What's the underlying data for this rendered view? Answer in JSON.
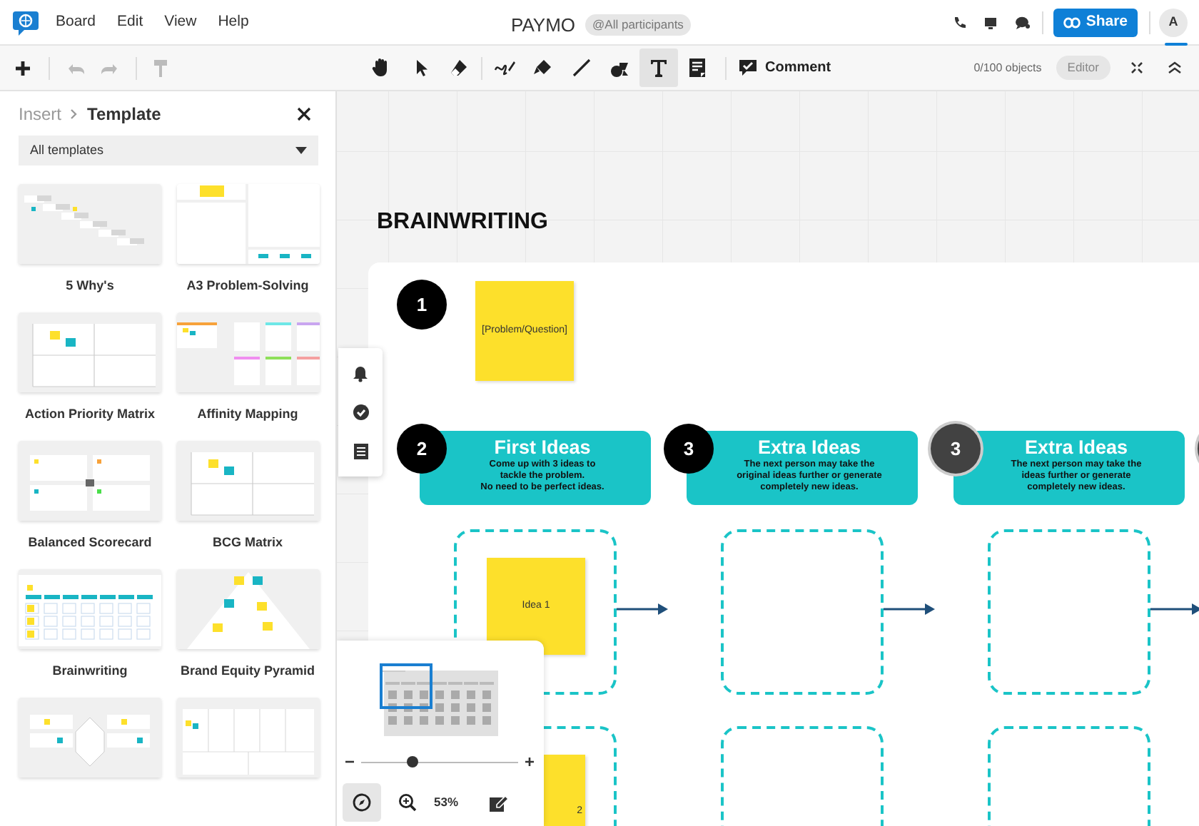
{
  "menu": [
    "Board",
    "Edit",
    "View",
    "Help"
  ],
  "board_title": "PAYMO",
  "participants_badge": "@All participants",
  "share_button": "Share",
  "avatar": "A",
  "toolbar": {
    "tools": [
      {
        "kind": "hand",
        "selected": false
      },
      {
        "kind": "pointer",
        "selected": false
      },
      {
        "kind": "eraser",
        "selected": false
      },
      {
        "kind": "pen",
        "selected": false
      },
      {
        "kind": "marker",
        "selected": false
      },
      {
        "kind": "line",
        "selected": false
      },
      {
        "kind": "shapes",
        "selected": false
      },
      {
        "kind": "text",
        "selected": true
      },
      {
        "kind": "note",
        "selected": false
      }
    ],
    "comment_button": "Comment",
    "object_count": "0/100 objects",
    "role_badge": "Editor"
  },
  "panel": {
    "breadcrumb_parent": "Insert",
    "breadcrumb_current": "Template",
    "filter": "All templates",
    "templates": [
      {
        "label": "5 Why's",
        "kind": "steps"
      },
      {
        "label": "A3 Problem-Solving",
        "kind": "layout"
      },
      {
        "label": "Action Priority Matrix",
        "kind": "matrix"
      },
      {
        "label": "Affinity Mapping",
        "kind": "columns"
      },
      {
        "label": "Balanced Scorecard",
        "kind": "scorecard"
      },
      {
        "label": "BCG Matrix",
        "kind": "matrix"
      },
      {
        "label": "Brainwriting",
        "kind": "grid"
      },
      {
        "label": "Brand Equity Pyramid",
        "kind": "pyramid"
      },
      {
        "kind": "radar"
      },
      {
        "kind": "canvas"
      }
    ]
  },
  "canvas": {
    "title": "BRAINWRITING",
    "problem": {
      "number": "1",
      "note": "[Problem/Question]"
    },
    "rounds": [
      {
        "number": "2",
        "color": "#000000",
        "title": "First Ideas",
        "text": "Come up with 3 ideas to\ntackle the problem.\nNo need to be perfect ideas.",
        "notes": [
          "Idea 1",
          "2"
        ]
      },
      {
        "number": "3",
        "color": "#000000",
        "title": "Extra Ideas",
        "text": "The next person may take the\noriginal ideas further or generate\ncompletely new ideas."
      },
      {
        "number": "3",
        "color": "#424242",
        "title": "Extra Ideas",
        "text": "The next person may take the\nideas further or generate\ncompletely new ideas."
      },
      {
        "color": "#424242"
      }
    ]
  },
  "minimap": {
    "level": 0.33,
    "zoom_reading": "53%"
  }
}
